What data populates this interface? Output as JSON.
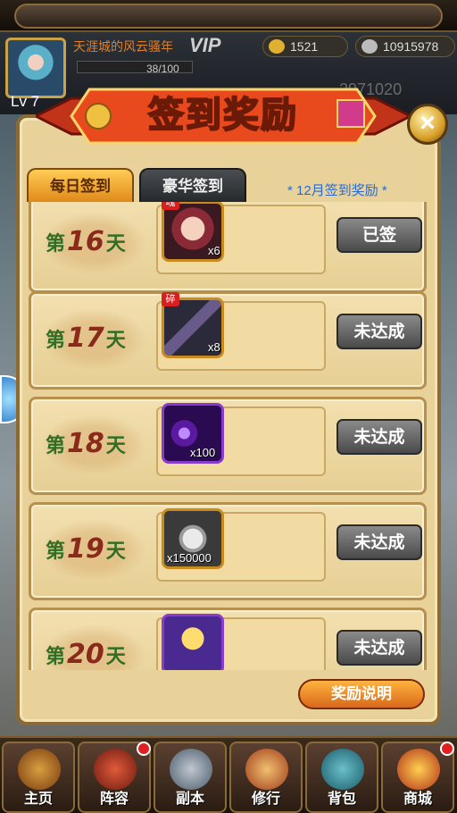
{
  "player": {
    "name": "天涯城的风云骚年",
    "vip": "VIP",
    "level": "Lv 7",
    "gold": "1521",
    "silver": "10915978",
    "energy_text": "38/100",
    "power": "2971020"
  },
  "panel": {
    "title": "签到奖励",
    "close": "×",
    "tabs": [
      {
        "label": "每日签到",
        "active": true
      },
      {
        "label": "豪华签到",
        "active": false
      }
    ],
    "month_label": "* 12月签到奖励 *",
    "explain_button": "奖励说明"
  },
  "rewards": [
    {
      "prefix": "第",
      "day": "16",
      "suffix": "天",
      "icon": "hero-portrait-icon",
      "tag": "魂",
      "qty": "x6",
      "status": "已签"
    },
    {
      "prefix": "第",
      "day": "17",
      "suffix": "天",
      "icon": "weapon-icon",
      "tag": "碎",
      "qty": "x8",
      "status": "未达成"
    },
    {
      "prefix": "第",
      "day": "18",
      "suffix": "天",
      "icon": "purple-orb-icon",
      "tag": "",
      "qty": "x100",
      "status": "未达成"
    },
    {
      "prefix": "第",
      "day": "19",
      "suffix": "天",
      "icon": "silver-coin-icon",
      "tag": "",
      "qty": "x150000",
      "status": "未达成"
    },
    {
      "prefix": "第",
      "day": "20",
      "suffix": "天",
      "icon": "medal-icon",
      "tag": "",
      "qty": "",
      "status": "未达成"
    }
  ],
  "nav": [
    {
      "label": "主页",
      "icon": "palace-icon",
      "badge": false
    },
    {
      "label": "阵容",
      "icon": "formation-icon",
      "badge": true
    },
    {
      "label": "副本",
      "icon": "crossed-swords-icon",
      "badge": false
    },
    {
      "label": "修行",
      "icon": "drum-icon",
      "badge": false
    },
    {
      "label": "背包",
      "icon": "bag-icon",
      "badge": false
    },
    {
      "label": "商城",
      "icon": "treasure-chest-icon",
      "badge": true
    }
  ]
}
